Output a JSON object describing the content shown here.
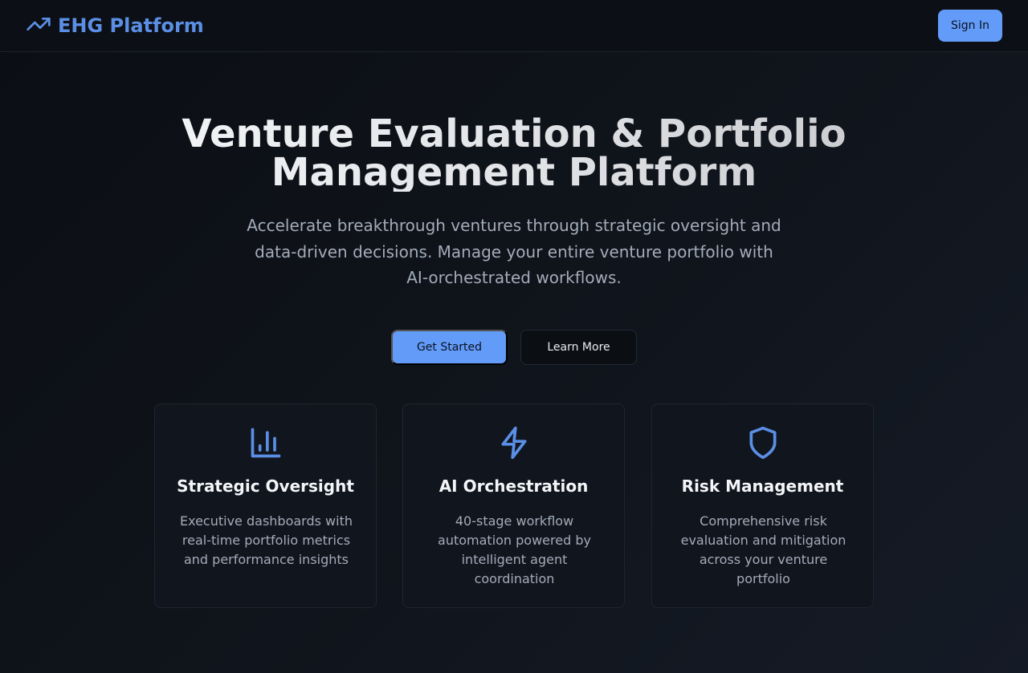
{
  "header": {
    "brand_icon": "trending-up-icon",
    "brand_name": "EHG Platform",
    "sign_in_label": "Sign In"
  },
  "hero": {
    "title_line1": "Venture Evaluation & Portfolio",
    "title_line2": "Management Platform",
    "subtitle_line1": "Accelerate breakthrough ventures through strategic oversight and",
    "subtitle_line2": "data-driven decisions. Manage your entire venture portfolio with",
    "subtitle_line3": "AI-orchestrated workflows.",
    "primary_cta": "Get Started",
    "secondary_cta": "Learn More"
  },
  "features": [
    {
      "icon": "bar-chart-icon",
      "title": "Strategic Oversight",
      "desc": "Executive dashboards with real-time portfolio metrics and performance insights"
    },
    {
      "icon": "lightning-icon",
      "title": "AI Orchestration",
      "desc": "40-stage workflow automation powered by intelligent agent coordination"
    },
    {
      "icon": "shield-icon",
      "title": "Risk Management",
      "desc": "Comprehensive risk evaluation and mitigation across your venture portfolio"
    }
  ],
  "colors": {
    "accent": "#629bf8",
    "brand": "#5b8fe6",
    "background": "#0f131a",
    "card": "#11151d",
    "muted_text": "#a3acba"
  }
}
